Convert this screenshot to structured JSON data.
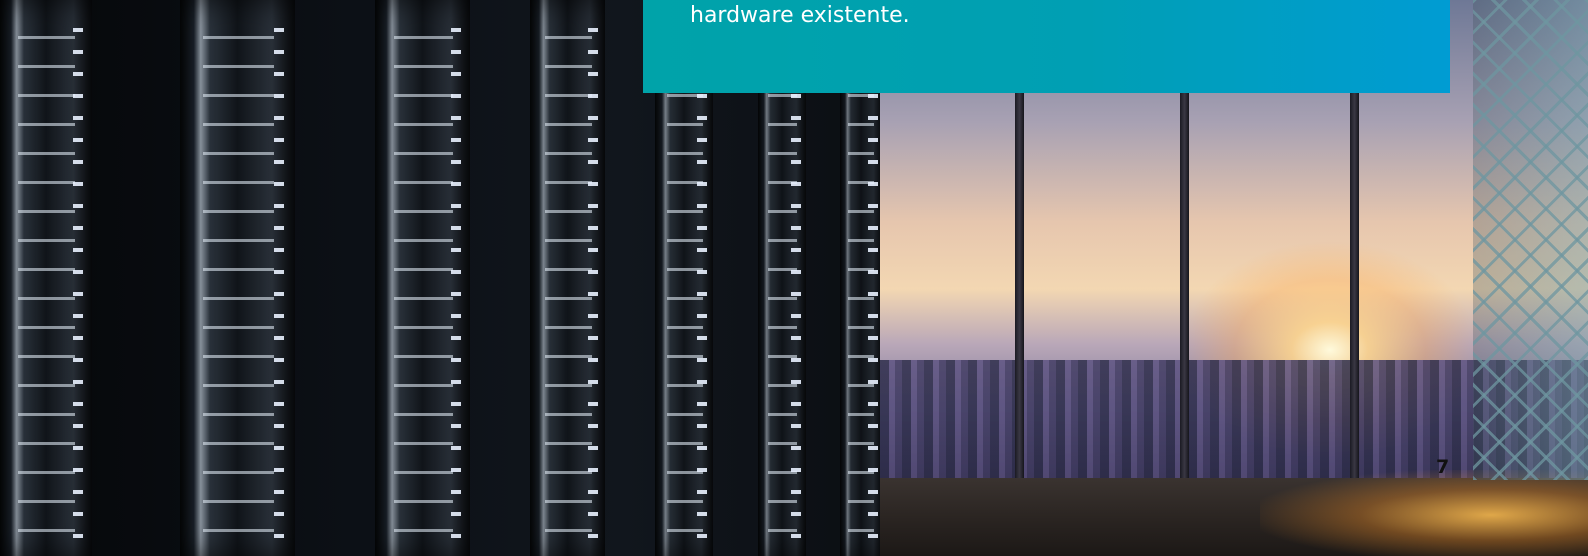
{
  "page": {
    "body_text_fragment": "hardware existente.",
    "page_number": "7"
  },
  "colors": {
    "banner_start": "#00a3a9",
    "banner_end": "#009cd3",
    "text": "#ffffff",
    "page_number": "#111111"
  },
  "images": {
    "left": "server-racks-photo",
    "right": "city-sunset-window-view"
  }
}
